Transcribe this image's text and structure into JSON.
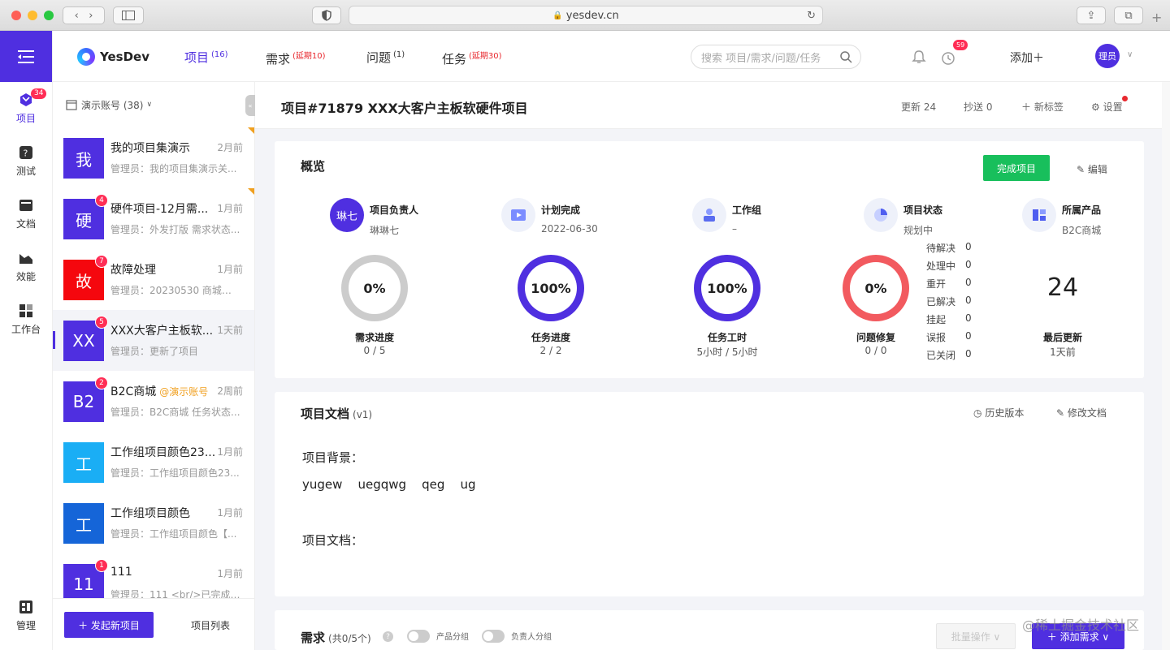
{
  "browser": {
    "url": "yesdev.cn"
  },
  "rail": {
    "items": [
      {
        "label": "项目",
        "badge": "34"
      },
      {
        "label": "测试"
      },
      {
        "label": "文档"
      },
      {
        "label": "效能"
      },
      {
        "label": "工作台"
      }
    ],
    "bottom_label": "管理"
  },
  "topnav": {
    "logo": "YesDev",
    "tabs": [
      {
        "label": "项目",
        "sup": "(16)"
      },
      {
        "label": "需求",
        "sup": "(延期10)"
      },
      {
        "label": "问题",
        "sup": "(1)"
      },
      {
        "label": "任务",
        "sup": "(延期30)"
      }
    ],
    "search_placeholder": "搜索 项目/需求/问题/任务",
    "timer_badge": "59",
    "add_label": "添加＋",
    "avatar": "理员"
  },
  "plist": {
    "account": "演示账号 (38)",
    "items": [
      {
        "thumb": "我",
        "color": "#4f2fe0",
        "title": "我的项目集演示",
        "tag": "",
        "time": "2月前",
        "desc": "管理员：我的项目集演示关...",
        "badge": "",
        "corner": true
      },
      {
        "thumb": "硬",
        "color": "#4f2fe0",
        "title": "硬件项目-12月需...",
        "tag": "",
        "time": "1月前",
        "desc": "管理员：外发打版 需求状态...",
        "badge": "4",
        "corner": true
      },
      {
        "thumb": "故",
        "color": "#f5070e",
        "title": "故障处理",
        "tag": "",
        "time": "1月前",
        "desc": "管理员：20230530 商城网...",
        "badge": "7",
        "corner": false
      },
      {
        "thumb": "XX",
        "color": "#4f2fe0",
        "title": "XXX大客户主板软...",
        "tag": "",
        "time": "1天前",
        "desc": "管理员：更新了项目",
        "badge": "5",
        "corner": false,
        "selected": true
      },
      {
        "thumb": "B2",
        "color": "#4f2fe0",
        "title": "B2C商城",
        "tag": "@演示账号",
        "time": "2周前",
        "desc": "管理员：B2C商城 任务状态...",
        "badge": "2",
        "corner": false
      },
      {
        "thumb": "工",
        "color": "#1aaef5",
        "title": "工作组项目颜色23...",
        "tag": "",
        "time": "1月前",
        "desc": "管理员：工作组项目颜色23...",
        "badge": "",
        "corner": false
      },
      {
        "thumb": "工",
        "color": "#1565d8",
        "title": "工作组项目颜色",
        "tag": "",
        "time": "1月前",
        "desc": "管理员：工作组项目颜色【...",
        "badge": "",
        "corner": false
      },
      {
        "thumb": "11",
        "color": "#4f2fe0",
        "title": "111",
        "tag": "",
        "time": "1月前",
        "desc": "管理员：111 <br/>已完成 需...",
        "badge": "1",
        "corner": false
      }
    ],
    "new_button": "＋ 发起新项目",
    "list_link": "项目列表"
  },
  "header": {
    "title": "项目#71879 XXX大客户主板软硬件项目",
    "updates": "更新 24",
    "cc": "抄送 0",
    "new_tag": "＋ 新标签",
    "settings": "设置"
  },
  "overview": {
    "title": "概览",
    "finish_button": "完成项目",
    "edit": "编辑",
    "info": [
      {
        "label": "项目负责人",
        "value": "琳琳七",
        "icon": "琳七"
      },
      {
        "label": "计划完成",
        "value": "2022-06-30"
      },
      {
        "label": "工作组",
        "value": "–"
      },
      {
        "label": "项目状态",
        "value": "规划中"
      },
      {
        "label": "所属产品",
        "value": "B2C商城"
      }
    ],
    "rings": [
      {
        "pct": "0%",
        "fill": 0,
        "label": "需求进度",
        "value": "0 / 5",
        "color": "#cccccc"
      },
      {
        "pct": "100%",
        "fill": 1,
        "label": "任务进度",
        "value": "2 / 2",
        "color": "#4f2fe0"
      },
      {
        "pct": "100%",
        "fill": 1,
        "label": "任务工时",
        "value": "5小时 / 5小时",
        "color": "#4f2fe0"
      },
      {
        "pct": "0%",
        "fill": 0,
        "label": "问题修复",
        "value": "0 / 0",
        "color": "#f25a5f"
      }
    ],
    "issues": [
      {
        "k": "待解决",
        "v": "0"
      },
      {
        "k": "处理中",
        "v": "0"
      },
      {
        "k": "重开",
        "v": "0"
      },
      {
        "k": "已解决",
        "v": "0"
      },
      {
        "k": "挂起",
        "v": "0"
      },
      {
        "k": "误报",
        "v": "0"
      },
      {
        "k": "已关闭",
        "v": "0"
      }
    ],
    "last_update_value": "24",
    "last_update_label": "最后更新",
    "last_update_time": "1天前"
  },
  "doc": {
    "title": "项目文档",
    "version": "(v1)",
    "history": "历史版本",
    "modify": "修改文档",
    "background_label": "项目背景：",
    "background_text": "yugew    uegqwg    qeg    ug",
    "doc_label": "项目文档："
  },
  "req": {
    "title": "需求",
    "count": "(共0/5个)",
    "toggle1": "产品分组",
    "toggle2": "负责人分组",
    "batch": "批量操作 ∨",
    "add": "＋ 添加需求 ∨"
  },
  "watermark": "@稀土掘金技术社区"
}
